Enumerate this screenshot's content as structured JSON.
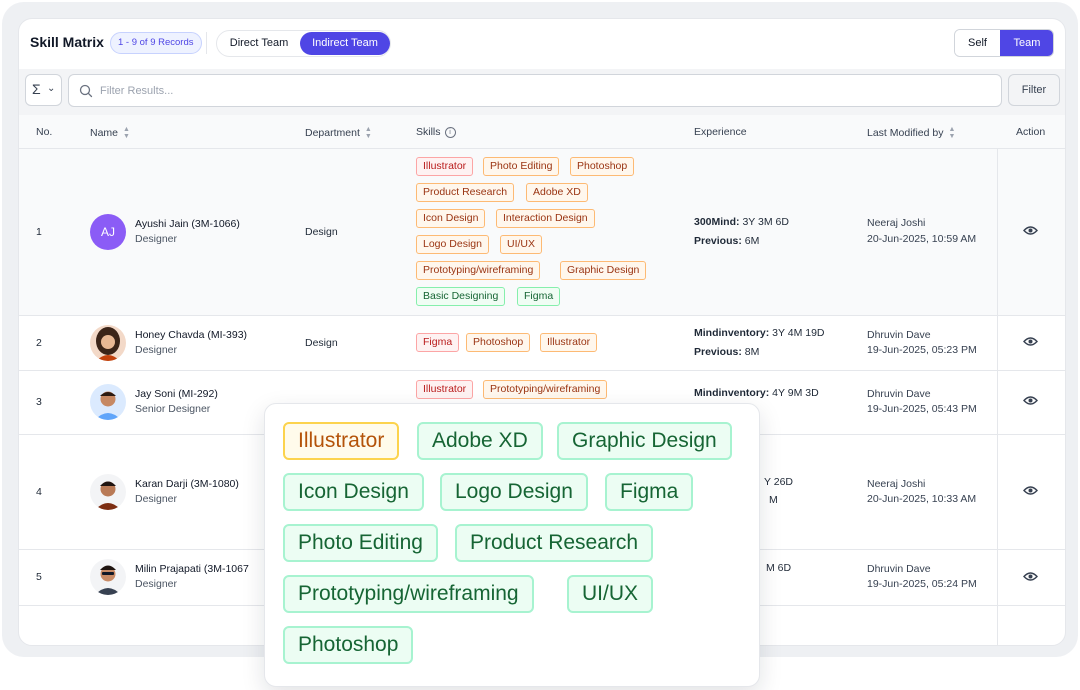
{
  "header": {
    "title": "Skill Matrix",
    "records_badge": "1 - 9 of 9 Records",
    "team_tabs": [
      "Direct Team",
      "Indirect Team"
    ],
    "view_toggle": [
      "Self",
      "Team"
    ]
  },
  "filters": {
    "sigma_label": "Σ",
    "search_placeholder": "Filter Results...",
    "filter_button": "Filter"
  },
  "table": {
    "columns": [
      "No.",
      "Name",
      "Department",
      "Skills",
      "Experience",
      "Last Modified by",
      "Action"
    ],
    "rows": [
      {
        "no": "1",
        "initials": "AJ",
        "name": "Ayushi Jain (3M-1066)",
        "role": "Designer",
        "department": "Design",
        "skills": [
          "Illustrator",
          "Photo Editing",
          "Photoshop",
          "Product Research",
          "Adobe XD",
          "Icon Design",
          "Interaction Design",
          "Logo Design",
          "UI/UX",
          "Prototyping/wireframing",
          "Graphic Design",
          "Basic Designing",
          "Figma"
        ],
        "exp_label1": "300Mind:",
        "exp_value1": "3Y 3M 6D",
        "exp_label2": "Previous:",
        "exp_value2": "6M",
        "modified_by": "Neeraj Joshi",
        "modified_at": "20-Jun-2025, 10:59 AM"
      },
      {
        "no": "2",
        "name": "Honey Chavda (MI-393)",
        "role": "Designer",
        "department": "Design",
        "skills": [
          "Figma",
          "Photoshop",
          "Illustrator"
        ],
        "exp_label1": "Mindinventory:",
        "exp_value1": "3Y 4M 19D",
        "exp_label2": "Previous:",
        "exp_value2": "8M",
        "modified_by": "Dhruvin Dave",
        "modified_at": "19-Jun-2025, 05:23 PM"
      },
      {
        "no": "3",
        "name": "Jay Soni (MI-292)",
        "role": "Senior Designer",
        "skills": [
          "Illustrator",
          "Prototyping/wireframing"
        ],
        "exp_label1": "Mindinventory:",
        "exp_value1": "4Y 9M 3D",
        "modified_by": "Dhruvin Dave",
        "modified_at": "19-Jun-2025, 05:43 PM"
      },
      {
        "no": "4",
        "name": "Karan Darji (3M-1080)",
        "role": "Designer",
        "exp_value1_partial": "Y 26D",
        "exp_value2_partial": "M",
        "modified_by": "Neeraj Joshi",
        "modified_at": "20-Jun-2025, 10:33 AM"
      },
      {
        "no": "5",
        "name": "Milin Prajapati (3M-1067",
        "role": "Designer",
        "exp_value1_partial": "M 6D",
        "modified_by": "Dhruvin Dave",
        "modified_at": "19-Jun-2025, 05:24 PM"
      }
    ]
  },
  "popover": {
    "skills": [
      "Illustrator",
      "Adobe XD",
      "Graphic Design",
      "Icon Design",
      "Logo Design",
      "Figma",
      "Photo Editing",
      "Product Research",
      "Prototyping/wireframing",
      "UI/UX",
      "Photoshop"
    ]
  },
  "colors": {
    "accent": "#4f46e5",
    "tag_red": "#b91c1c",
    "tag_orange": "#9a3412",
    "tag_green": "#166534",
    "avatar_initials_bg": "#8b5cf6"
  }
}
